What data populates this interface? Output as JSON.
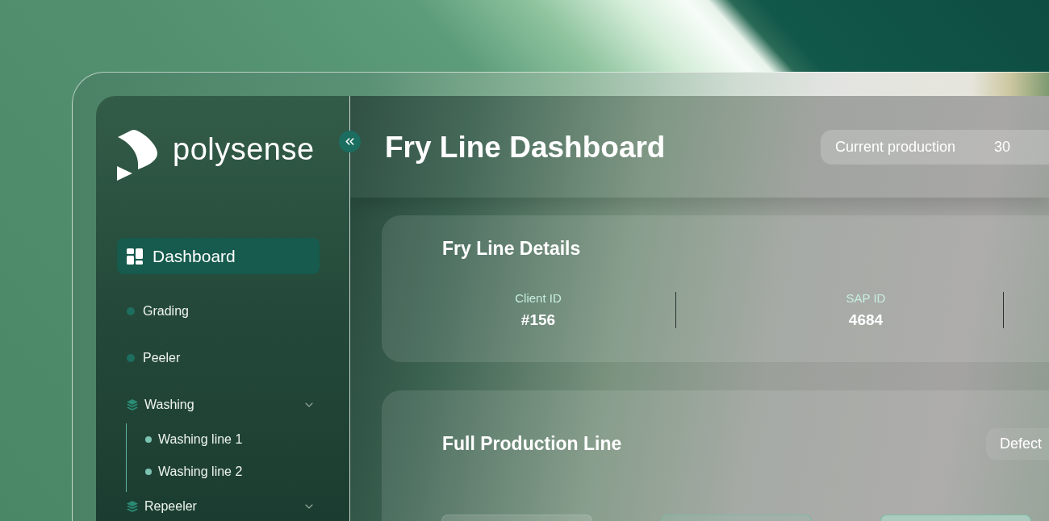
{
  "sidebar": {
    "logo": "polysense",
    "items": [
      {
        "label": "Dashboard",
        "kind": "dashboard",
        "selected": true
      },
      {
        "label": "Grading",
        "kind": "dot",
        "selected": false
      },
      {
        "label": "Peeler",
        "kind": "dot",
        "selected": false
      },
      {
        "label": "Washing",
        "kind": "group",
        "selected": false,
        "children": [
          {
            "label": "Washing line 1",
            "selected": false
          },
          {
            "label": "Washing line 2",
            "selected": false
          }
        ]
      },
      {
        "label": "Repeeler",
        "kind": "group",
        "selected": false
      }
    ]
  },
  "header": {
    "title": "Fry Line Dashboard",
    "production": {
      "label": "Current production",
      "value": "30"
    }
  },
  "details": {
    "title": "Fry Line Details",
    "fields": [
      {
        "label": "Client ID",
        "value": "#156"
      },
      {
        "label": "SAP ID",
        "value": "4684"
      }
    ]
  },
  "production_line": {
    "title": "Full Production Line",
    "filter": "Defect",
    "stages": [
      {
        "kind": "plain"
      },
      {
        "kind": "outlined"
      },
      {
        "kind": "highlighted"
      }
    ]
  }
}
